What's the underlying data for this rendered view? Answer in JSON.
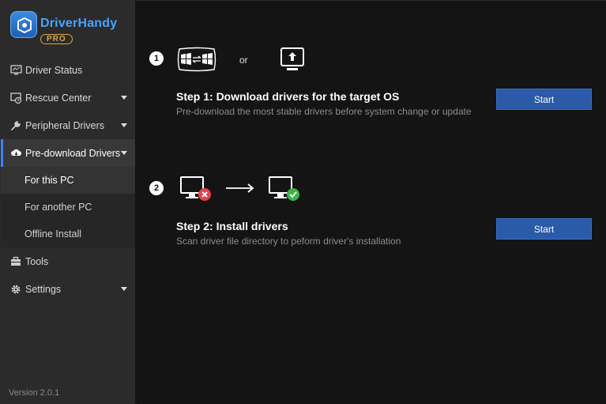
{
  "app": {
    "name": "DriverHandy",
    "edition": "PRO",
    "version": "Version 2.0.1"
  },
  "sidebar": {
    "items": [
      {
        "label": "Driver Status",
        "icon": "monitor-icon",
        "has_caret": false
      },
      {
        "label": "Rescue Center",
        "icon": "rescue-icon",
        "has_caret": true
      },
      {
        "label": "Peripheral Drivers",
        "icon": "wrench-icon",
        "has_caret": true
      },
      {
        "label": "Pre-download Drivers",
        "icon": "cloud-download-icon",
        "has_caret": true,
        "active": true
      },
      {
        "label": "Tools",
        "icon": "toolbox-icon",
        "has_caret": false
      },
      {
        "label": "Settings",
        "icon": "gear-icon",
        "has_caret": true
      }
    ],
    "subitems": [
      {
        "label": "For this PC",
        "current": true
      },
      {
        "label": "For another PC"
      },
      {
        "label": "Offline Install"
      }
    ]
  },
  "window_controls": [
    "feedback-icon",
    "menu-icon",
    "minimize-icon",
    "close-icon"
  ],
  "main": {
    "step1": {
      "number": "1",
      "or_text": "or",
      "title": "Step 1: Download drivers for the target OS",
      "desc": "Pre-download the most stable drivers before system change or update",
      "button": "Start"
    },
    "step2": {
      "number": "2",
      "title": "Step 2: Install drivers",
      "desc": "Scan driver file directory to peform driver's installation",
      "button": "Start"
    }
  },
  "colors": {
    "accent": "#3b82f6",
    "button": "#2a5aa8",
    "sidebar": "#2b2b2b",
    "main_bg": "#141414",
    "error": "#e0444a",
    "success": "#3bb54a"
  }
}
